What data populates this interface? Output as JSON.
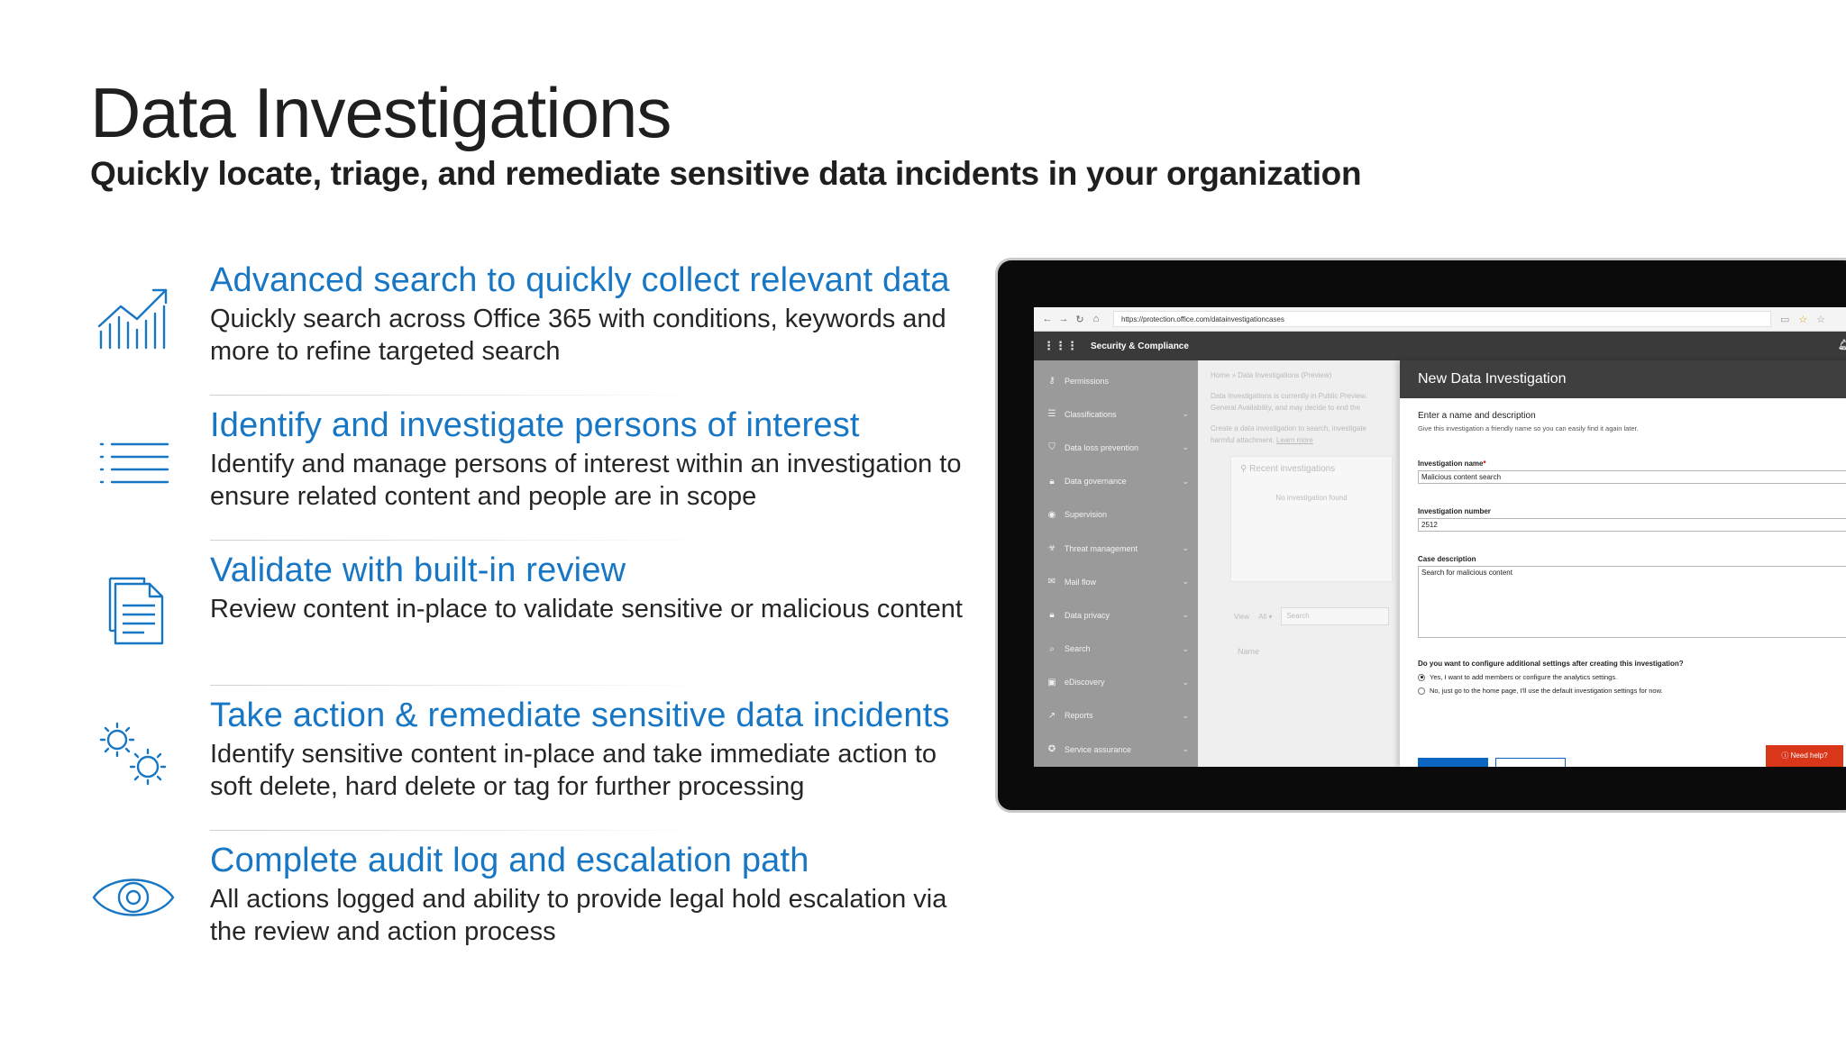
{
  "slide": {
    "title": "Data Investigations",
    "subtitle": "Quickly locate, triage, and remediate sensitive data incidents in your organization",
    "accent_color": "#1777c5"
  },
  "features": [
    {
      "icon": "chart-growth-icon",
      "title": "Advanced search to quickly collect relevant data",
      "description": "Quickly search across Office 365 with conditions, keywords and more to refine targeted search"
    },
    {
      "icon": "list-icon",
      "title": "Identify and investigate persons of interest",
      "description": "Identify and manage persons of interest within an investigation to ensure related content and people are in scope"
    },
    {
      "icon": "document-icon",
      "title": "Validate with built-in review",
      "description": "Review content in-place to validate sensitive or malicious content"
    },
    {
      "icon": "gears-icon",
      "title": "Take action & remediate sensitive data incidents",
      "description": "Identify sensitive content in-place and take immediate action to soft delete, hard delete or tag for further processing"
    },
    {
      "icon": "eye-icon",
      "title": "Complete audit log and escalation path",
      "description": "All actions logged and ability to provide legal hold escalation via the review and action process"
    }
  ],
  "screenshot": {
    "url": "https://protection.office.com/datainvestigationcases",
    "app_title": "Security & Compliance",
    "nav_items": [
      {
        "icon": "key-icon",
        "label": "Permissions"
      },
      {
        "icon": "list-icon",
        "label": "Classifications"
      },
      {
        "icon": "shield-icon",
        "label": "Data loss prevention"
      },
      {
        "icon": "lock-icon",
        "label": "Data governance"
      },
      {
        "icon": "eye-icon",
        "label": "Supervision"
      },
      {
        "icon": "biohazard-icon",
        "label": "Threat management"
      },
      {
        "icon": "mail-icon",
        "label": "Mail flow"
      },
      {
        "icon": "lock-icon",
        "label": "Data privacy"
      },
      {
        "icon": "search-icon",
        "label": "Search"
      },
      {
        "icon": "folder-icon",
        "label": "eDiscovery"
      },
      {
        "icon": "chart-icon",
        "label": "Reports"
      },
      {
        "icon": "ribbon-icon",
        "label": "Service assurance"
      }
    ],
    "breadcrumb": "Home  »  Data Investigations (Preview)",
    "intro_text": "Data Investigations is currently in Public Preview. General Availability, and may decide to end the",
    "intro_text2": "Create a data investigation to search, investigate harmful attachment.",
    "learn_more": "Learn more",
    "recent_title": "Recent investigations",
    "no_investigation": "No investigation found",
    "view_label": "View",
    "view_value": "All",
    "search_placeholder": "Search",
    "name_column": "Name",
    "panel": {
      "title": "New Data Investigation",
      "heading": "Enter a name and description",
      "help": "Give this investigation a friendly name so you can easily find it again later.",
      "name_label": "Investigation name",
      "name_value": "Malicious content search",
      "number_label": "Investigation number",
      "number_value": "2512",
      "desc_label": "Case description",
      "desc_value": "Search for malicious content",
      "question": "Do you want to configure additional settings after creating this investigation?",
      "option_yes": "Yes, I want to add members or configure the analytics settings.",
      "option_no": "No, just go to the home page, I'll use the default investigation settings for now.",
      "help_button": "Need help?"
    }
  }
}
